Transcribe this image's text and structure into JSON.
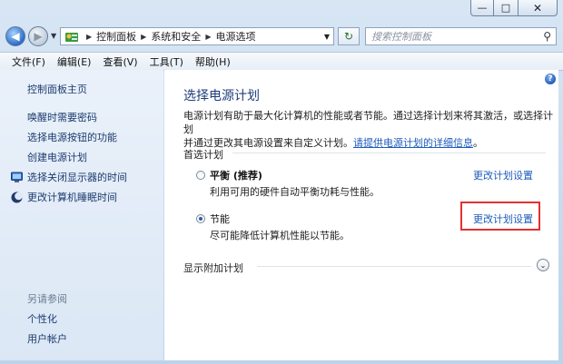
{
  "window": {
    "minimize_glyph": "—",
    "maximize_glyph": "□",
    "close_glyph": "✕"
  },
  "nav": {
    "breadcrumb": [
      "控制面板",
      "系统和安全",
      "电源选项"
    ],
    "search_placeholder": "搜索控制面板"
  },
  "menu": [
    "文件(F)",
    "编辑(E)",
    "查看(V)",
    "工具(T)",
    "帮助(H)"
  ],
  "sidebar": {
    "home": "控制面板主页",
    "items": [
      {
        "label": "唤醒时需要密码",
        "icon": ""
      },
      {
        "label": "选择电源按钮的功能",
        "icon": ""
      },
      {
        "label": "创建电源计划",
        "icon": ""
      },
      {
        "label": "选择关闭显示器的时间",
        "icon": "monitor-icon"
      },
      {
        "label": "更改计算机睡眠时间",
        "icon": "moon-icon"
      }
    ],
    "see_also_title": "另请参阅",
    "see_also": [
      "个性化",
      "用户帐户"
    ]
  },
  "main": {
    "title": "选择电源计划",
    "description_line1": "电源计划有助于最大化计算机的性能或者节能。通过选择计划来将其激活，或选择计划",
    "description_line2_prefix": "并通过更改其电源设置来自定义计划。",
    "description_link": "请提供电源计划的详细信息",
    "description_line2_suffix": "。",
    "preferred_group": "首选计划",
    "plans": [
      {
        "name": "平衡 (推荐)",
        "desc": "利用可用的硬件自动平衡功耗与性能。",
        "link": "更改计划设置",
        "selected": false
      },
      {
        "name": "节能",
        "desc": "尽可能降低计算机性能以节能。",
        "link": "更改计划设置",
        "selected": true
      }
    ],
    "more_plans": "显示附加计划"
  }
}
